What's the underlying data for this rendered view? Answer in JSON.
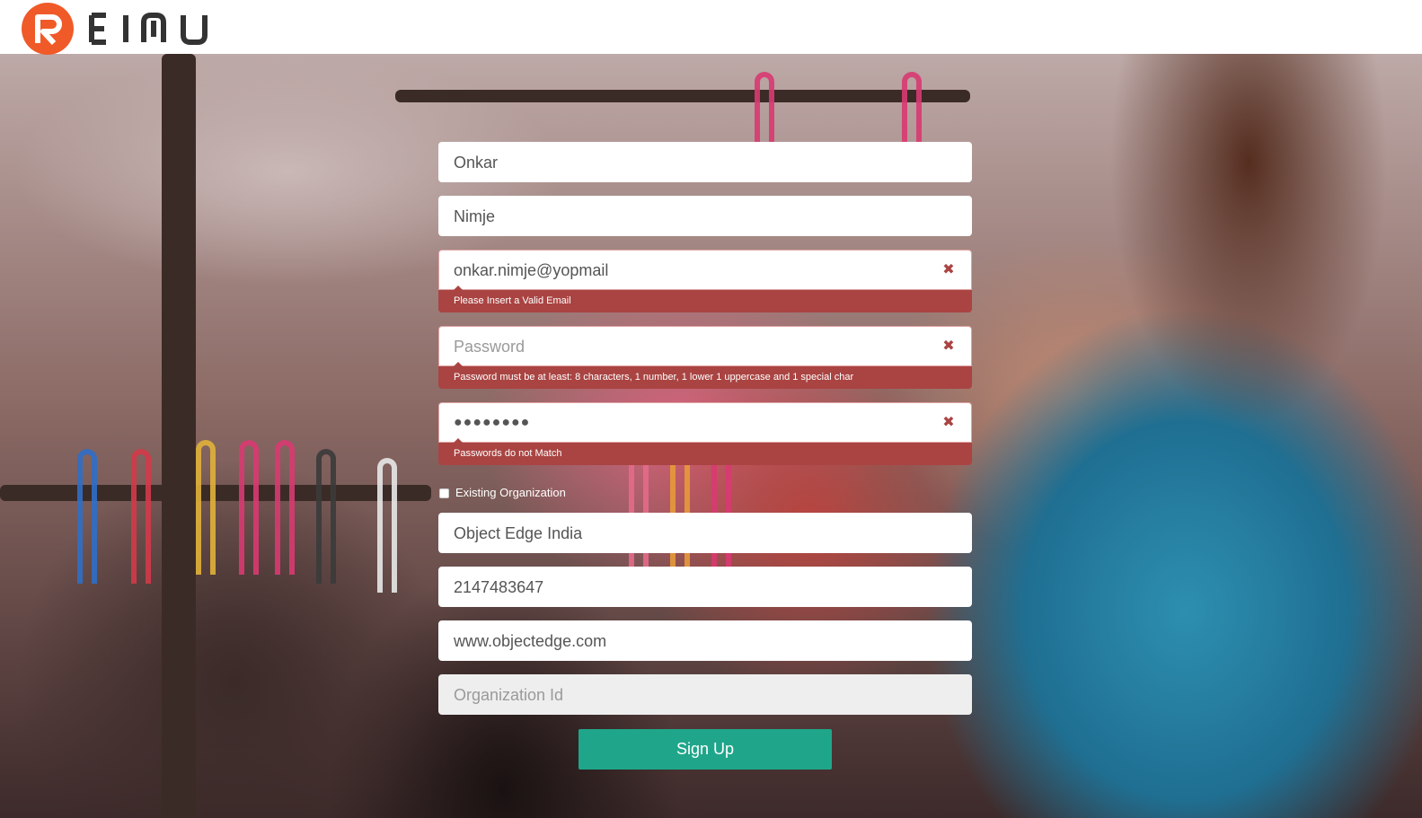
{
  "header": {
    "logo_text": "REIMU",
    "brand_color": "#f05a28"
  },
  "form": {
    "first_name": {
      "value": "Onkar"
    },
    "last_name": {
      "value": "Nimje"
    },
    "email": {
      "value": "onkar.nimje@yopmail",
      "error": "Please Insert a Valid Email"
    },
    "password": {
      "placeholder": "Password",
      "error": "Password must be at least: 8 characters, 1 number, 1 lower 1 uppercase and 1 special char"
    },
    "confirm_password": {
      "value": "●●●●●●●●",
      "error": "Passwords do not Match"
    },
    "existing_org": {
      "label": "Existing Organization",
      "checked": false
    },
    "organization_name": {
      "value": "Object Edge India"
    },
    "phone": {
      "value": "2147483647"
    },
    "website": {
      "value": "www.objectedge.com"
    },
    "organization_id": {
      "placeholder": "Organization Id",
      "disabled": true
    },
    "submit_label": "Sign Up"
  },
  "colors": {
    "error": "#a94442",
    "submit": "#1fa68a"
  },
  "icons": {
    "error_icon": "close-icon"
  }
}
